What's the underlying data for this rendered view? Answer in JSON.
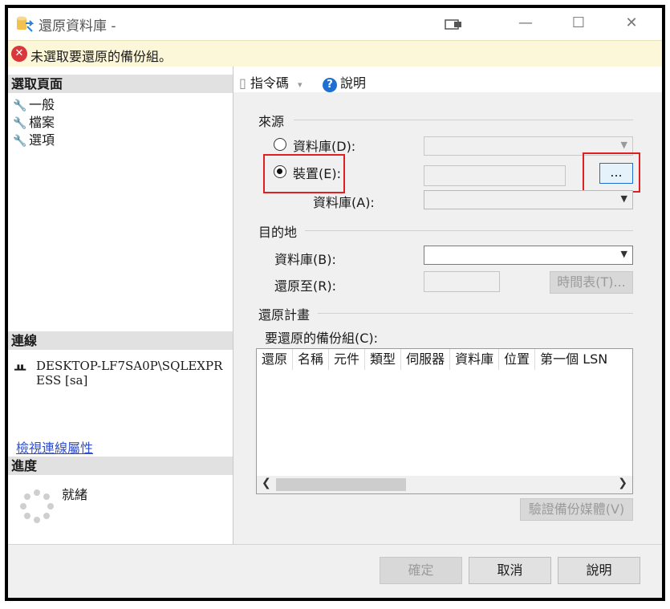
{
  "window": {
    "title": "還原資料庫 -",
    "minimize": "—",
    "maximize": "☐",
    "close": "✕"
  },
  "error_bar": {
    "icon": "error-icon",
    "message": "未選取要還原的備份組。"
  },
  "left": {
    "select_page_header": "選取頁面",
    "pages": [
      {
        "label": "一般"
      },
      {
        "label": "檔案"
      },
      {
        "label": "選項"
      }
    ],
    "connection_header": "連線",
    "connection_text": "DESKTOP-LF7SA0P\\SQLEXPRESS [sa]",
    "view_connection_link": "檢視連線屬性",
    "progress_header": "進度",
    "progress_status": "就緒"
  },
  "toolbar": {
    "script_label": "指令碼",
    "help_label": "說明"
  },
  "source": {
    "group_label": "來源",
    "database_radio": "資料庫(D):",
    "device_radio": "裝置(E):",
    "device_selected": true,
    "browse_button": "...",
    "database_a_label": "資料庫(A):"
  },
  "destination": {
    "group_label": "目的地",
    "database_b_label": "資料庫(B):",
    "restore_to_label": "還原至(R):",
    "timeline_button": "時間表(T)..."
  },
  "restore_plan": {
    "group_label": "還原計畫",
    "backup_sets_label": "要還原的備份組(C):",
    "columns": [
      "還原",
      "名稱",
      "元件",
      "類型",
      "伺服器",
      "資料庫",
      "位置",
      "第一個 LSN"
    ],
    "verify_button": "驗證備份媒體(V)"
  },
  "buttons": {
    "ok": "確定",
    "cancel": "取消",
    "help": "說明"
  },
  "colors": {
    "highlight_box": "#e02020",
    "error_bar_bg": "#fcf7d9",
    "link": "#2f4fd0"
  }
}
